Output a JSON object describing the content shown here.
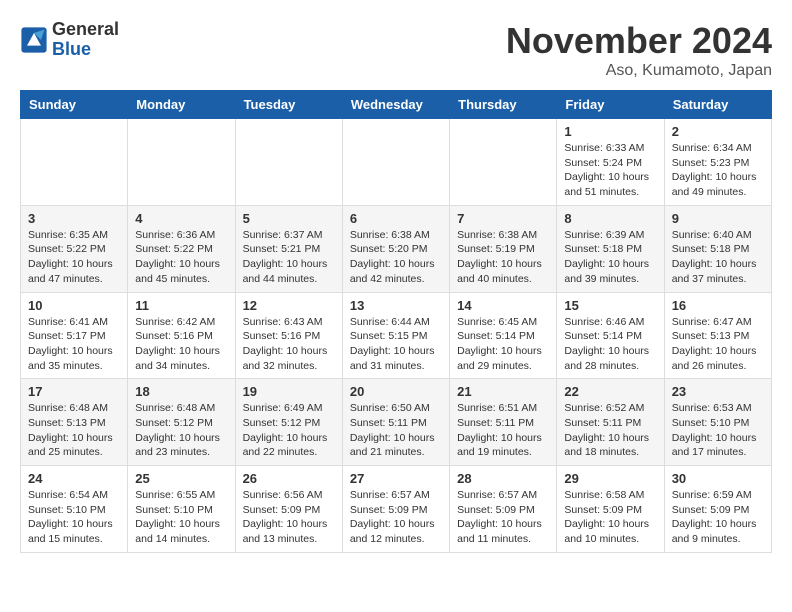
{
  "logo": {
    "general": "General",
    "blue": "Blue"
  },
  "header": {
    "month": "November 2024",
    "location": "Aso, Kumamoto, Japan"
  },
  "weekdays": [
    "Sunday",
    "Monday",
    "Tuesday",
    "Wednesday",
    "Thursday",
    "Friday",
    "Saturday"
  ],
  "weeks": [
    [
      {
        "day": "",
        "info": ""
      },
      {
        "day": "",
        "info": ""
      },
      {
        "day": "",
        "info": ""
      },
      {
        "day": "",
        "info": ""
      },
      {
        "day": "",
        "info": ""
      },
      {
        "day": "1",
        "info": "Sunrise: 6:33 AM\nSunset: 5:24 PM\nDaylight: 10 hours and 51 minutes."
      },
      {
        "day": "2",
        "info": "Sunrise: 6:34 AM\nSunset: 5:23 PM\nDaylight: 10 hours and 49 minutes."
      }
    ],
    [
      {
        "day": "3",
        "info": "Sunrise: 6:35 AM\nSunset: 5:22 PM\nDaylight: 10 hours and 47 minutes."
      },
      {
        "day": "4",
        "info": "Sunrise: 6:36 AM\nSunset: 5:22 PM\nDaylight: 10 hours and 45 minutes."
      },
      {
        "day": "5",
        "info": "Sunrise: 6:37 AM\nSunset: 5:21 PM\nDaylight: 10 hours and 44 minutes."
      },
      {
        "day": "6",
        "info": "Sunrise: 6:38 AM\nSunset: 5:20 PM\nDaylight: 10 hours and 42 minutes."
      },
      {
        "day": "7",
        "info": "Sunrise: 6:38 AM\nSunset: 5:19 PM\nDaylight: 10 hours and 40 minutes."
      },
      {
        "day": "8",
        "info": "Sunrise: 6:39 AM\nSunset: 5:18 PM\nDaylight: 10 hours and 39 minutes."
      },
      {
        "day": "9",
        "info": "Sunrise: 6:40 AM\nSunset: 5:18 PM\nDaylight: 10 hours and 37 minutes."
      }
    ],
    [
      {
        "day": "10",
        "info": "Sunrise: 6:41 AM\nSunset: 5:17 PM\nDaylight: 10 hours and 35 minutes."
      },
      {
        "day": "11",
        "info": "Sunrise: 6:42 AM\nSunset: 5:16 PM\nDaylight: 10 hours and 34 minutes."
      },
      {
        "day": "12",
        "info": "Sunrise: 6:43 AM\nSunset: 5:16 PM\nDaylight: 10 hours and 32 minutes."
      },
      {
        "day": "13",
        "info": "Sunrise: 6:44 AM\nSunset: 5:15 PM\nDaylight: 10 hours and 31 minutes."
      },
      {
        "day": "14",
        "info": "Sunrise: 6:45 AM\nSunset: 5:14 PM\nDaylight: 10 hours and 29 minutes."
      },
      {
        "day": "15",
        "info": "Sunrise: 6:46 AM\nSunset: 5:14 PM\nDaylight: 10 hours and 28 minutes."
      },
      {
        "day": "16",
        "info": "Sunrise: 6:47 AM\nSunset: 5:13 PM\nDaylight: 10 hours and 26 minutes."
      }
    ],
    [
      {
        "day": "17",
        "info": "Sunrise: 6:48 AM\nSunset: 5:13 PM\nDaylight: 10 hours and 25 minutes."
      },
      {
        "day": "18",
        "info": "Sunrise: 6:48 AM\nSunset: 5:12 PM\nDaylight: 10 hours and 23 minutes."
      },
      {
        "day": "19",
        "info": "Sunrise: 6:49 AM\nSunset: 5:12 PM\nDaylight: 10 hours and 22 minutes."
      },
      {
        "day": "20",
        "info": "Sunrise: 6:50 AM\nSunset: 5:11 PM\nDaylight: 10 hours and 21 minutes."
      },
      {
        "day": "21",
        "info": "Sunrise: 6:51 AM\nSunset: 5:11 PM\nDaylight: 10 hours and 19 minutes."
      },
      {
        "day": "22",
        "info": "Sunrise: 6:52 AM\nSunset: 5:11 PM\nDaylight: 10 hours and 18 minutes."
      },
      {
        "day": "23",
        "info": "Sunrise: 6:53 AM\nSunset: 5:10 PM\nDaylight: 10 hours and 17 minutes."
      }
    ],
    [
      {
        "day": "24",
        "info": "Sunrise: 6:54 AM\nSunset: 5:10 PM\nDaylight: 10 hours and 15 minutes."
      },
      {
        "day": "25",
        "info": "Sunrise: 6:55 AM\nSunset: 5:10 PM\nDaylight: 10 hours and 14 minutes."
      },
      {
        "day": "26",
        "info": "Sunrise: 6:56 AM\nSunset: 5:09 PM\nDaylight: 10 hours and 13 minutes."
      },
      {
        "day": "27",
        "info": "Sunrise: 6:57 AM\nSunset: 5:09 PM\nDaylight: 10 hours and 12 minutes."
      },
      {
        "day": "28",
        "info": "Sunrise: 6:57 AM\nSunset: 5:09 PM\nDaylight: 10 hours and 11 minutes."
      },
      {
        "day": "29",
        "info": "Sunrise: 6:58 AM\nSunset: 5:09 PM\nDaylight: 10 hours and 10 minutes."
      },
      {
        "day": "30",
        "info": "Sunrise: 6:59 AM\nSunset: 5:09 PM\nDaylight: 10 hours and 9 minutes."
      }
    ]
  ]
}
